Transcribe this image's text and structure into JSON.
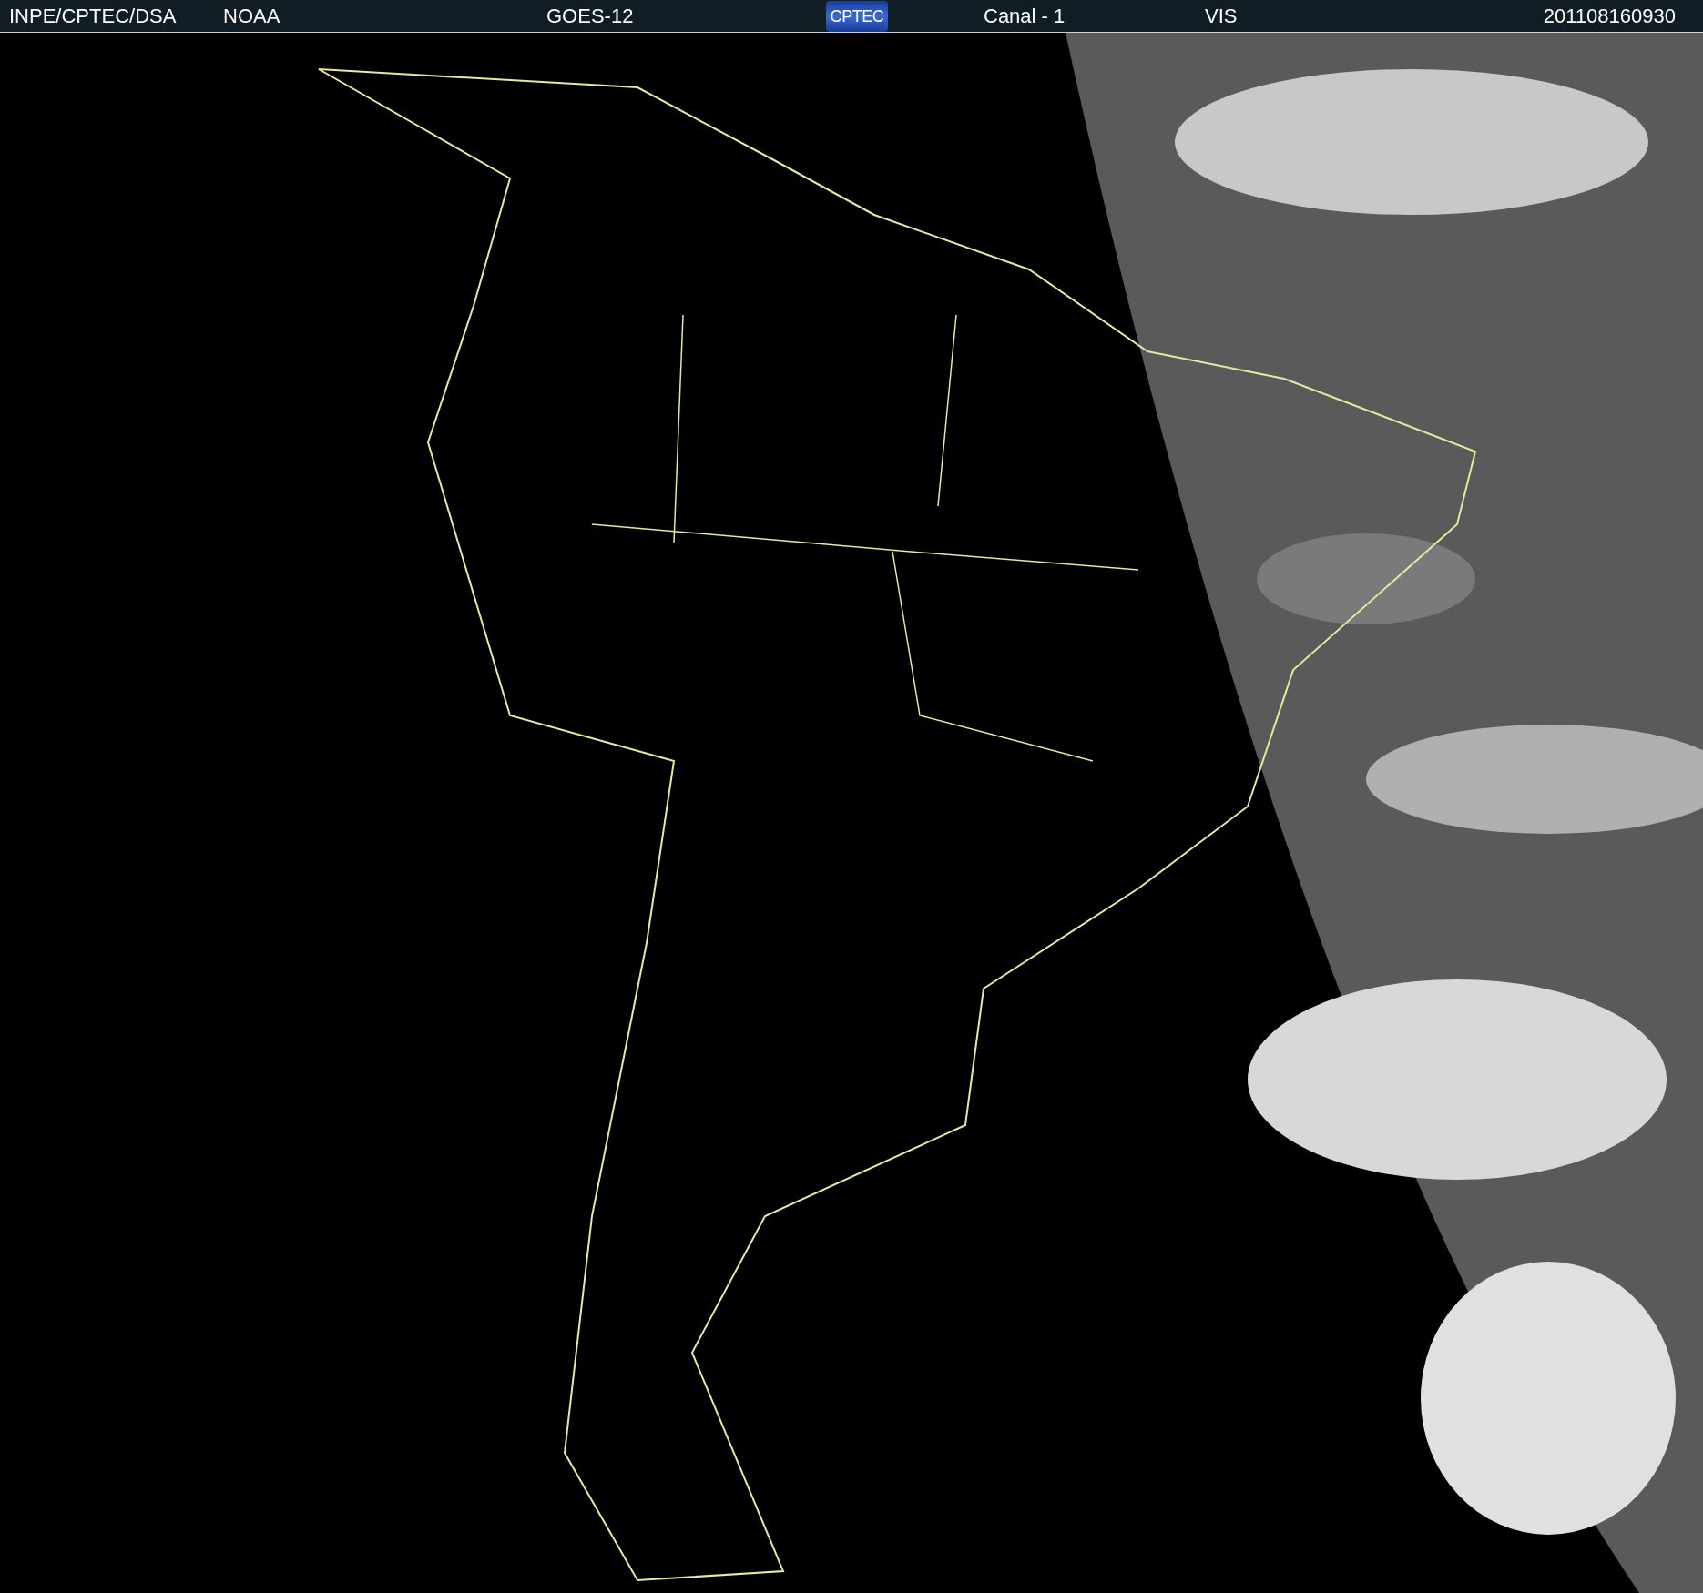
{
  "header": {
    "items": [
      {
        "kind": "text",
        "text": "INPE/CPTEC/DSA"
      },
      {
        "kind": "text",
        "text": "NOAA"
      },
      {
        "kind": "text",
        "text": "GOES-12"
      },
      {
        "kind": "logo",
        "text": "CPTEC"
      },
      {
        "kind": "text",
        "text": "Canal - 1"
      },
      {
        "kind": "text",
        "text": "VIS"
      },
      {
        "kind": "text",
        "text": "201108160930"
      }
    ]
  }
}
